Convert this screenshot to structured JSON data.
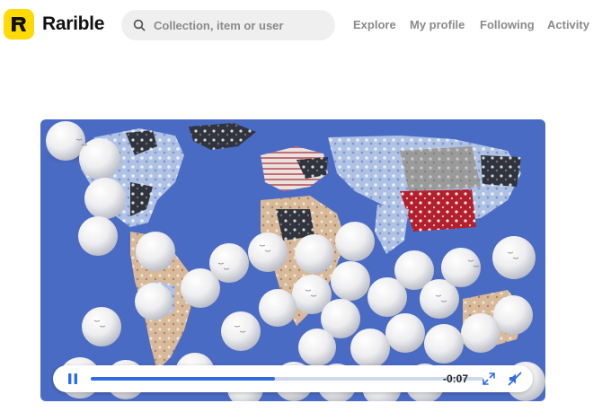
{
  "header": {
    "logo_letter": "R",
    "brand": "Rarible",
    "search": {
      "placeholder": "Collection, item or user",
      "value": ""
    },
    "nav": [
      {
        "label": "Explore"
      },
      {
        "label": "My profile"
      },
      {
        "label": "Following"
      },
      {
        "label": "Activity"
      }
    ]
  },
  "media": {
    "type": "video",
    "player": {
      "state": "playing",
      "time_remaining": "-0:07",
      "progress": 0.47,
      "icons": [
        "pause-icon",
        "fullscreen-icon",
        "volume-muted-icon"
      ]
    }
  },
  "colors": {
    "brand_yellow": "#FEDA03",
    "ocean": "#4A6BC4",
    "progress_fill": "#2F6DE1",
    "nav_text": "#8A8A8A"
  }
}
